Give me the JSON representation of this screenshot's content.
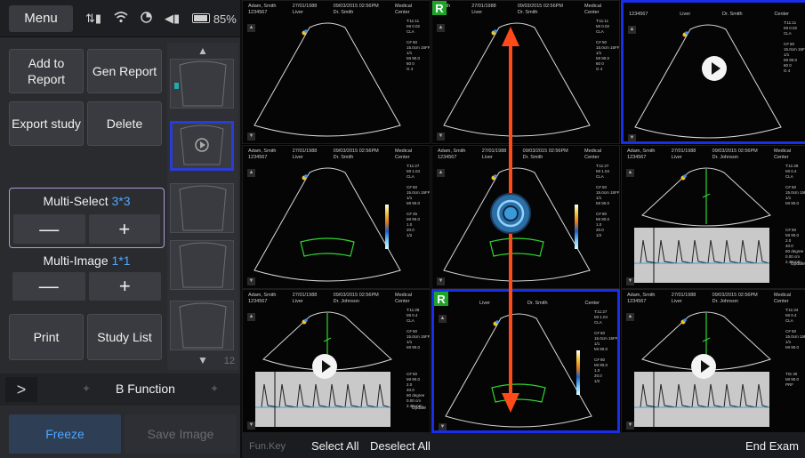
{
  "menu": {
    "label": "Menu"
  },
  "status": {
    "battery": "85%"
  },
  "buttons": {
    "add_to_report": "Add to\nReport",
    "gen_report": "Gen Report",
    "export_study": "Export study",
    "delete": "Delete",
    "print": "Print",
    "study_list": "Study List",
    "freeze": "Freeze",
    "save_image": "Save Image"
  },
  "multi_select": {
    "label": "Multi-Select",
    "value": "3*3",
    "minus": "—",
    "plus": "+"
  },
  "multi_image": {
    "label": "Multi-Image",
    "value": "1*1",
    "minus": "—",
    "plus": "+"
  },
  "thumbs": {
    "count": "12"
  },
  "bfunction": {
    "arrow": ">",
    "label": "B Function"
  },
  "bottom": {
    "fun_key": "Fun.Key",
    "select_all": "Select All",
    "deselect_all": "Deselect All",
    "end_exam": "End Exam"
  },
  "cells": [
    {
      "patient": "Adam, Smith\n1234567",
      "date": "27/01/1988\nLiver",
      "time": "09/03/2015 02:56PM\nDr. Smith",
      "center": "Medical\nCenter",
      "params": "T:11:11\nMI 0.02\nCLA\n\nC# 50\n15.0cm 15FPS\n1/1\nMI 90.0\n60 0\nG 4"
    },
    {
      "patient": "Smith\n",
      "date": "27/01/1988\nLiver",
      "time": "09/03/2015 02:56PM\nDr. Smith",
      "center": "Medical\nCenter",
      "params": "T:11:11\nMI 0.02\nCLA\n\nC# 50\n15.0cm 15FPS\n1/1\nMI 90.0\n60 0\nG 4",
      "tag": "R"
    },
    {
      "patient": "\n1234567",
      "date": "\nLiver",
      "time": "\nDr. Smith",
      "center": "\nCenter",
      "params": "T:11:11\nMI 0.02\nCLA\n\nC# 50\n15.0cm 15FPS\n1/1\nMI 90.0\n60 0\nG 4"
    },
    {
      "patient": "Adam, Smith\n1234567",
      "date": "27/01/1988\nLiver",
      "time": "09/03/2015 02:56PM\nDr. Smith",
      "center": "Medical\nCenter",
      "params": "T:11:27\nMI 1.04\nCLA\n\nC# 50\n15.0cm 15FPS\n1/1\nMI 90.0\n\nC# 45\nMI 90.0\n1.0\n20.0\n1/2"
    },
    {
      "patient": "Adam, Smith\n1234567",
      "date": "27/01/1988\nLiver",
      "time": "09/03/2015 02:56PM\nDr. Smith",
      "center": "Medical\nCenter",
      "params": "T:11:27\nMI 1.04\nCLA\n\nC# 50\n15.0cm 15FPS\n1/1\nMI 90.0\n\nC# 80\nMI 90.0\n1.0\n20.0\n1/2"
    },
    {
      "patient": "Adam, Smith\n1234567",
      "date": "27/01/1988\nLiver",
      "time": "09/03/2015 02:56PM\nDr. Johnson",
      "center": "Medical\nCenter",
      "params": "T:11:28\nMI 0.4\nCLA\n\nC# 50\n15.0cm 15FPS\n1/1\nMI 90.0\n\n\n\n\nC# 50\nMI 90.0\n2.0\n40.0\n60 degree\n0.00 cm\n2.48 mm",
      "update": "Update"
    },
    {
      "patient": "Adam, Smith\n1234567",
      "date": "27/01/1988\nLiver",
      "time": "09/03/2015 02:56PM\nDr. Johnson",
      "center": "Medical\nCenter",
      "params": "T:11:28\nMI 0.4\nCLA\n\nC# 50\n15.0cm 15FPS\n1/1\nMI 90.0\n\n\n\n\nC# 50\nMI 90.0\n2.0\n40.0\n60 degree\n0.00 cm\n2.48 mm",
      "update": "Update"
    },
    {
      "patient": "7\n",
      "date": "\nLiver",
      "time": "\nDr. Smith",
      "center": "\nCenter",
      "params": "T:11:27\nMI 1.04\nCLA\n\nC# 50\n15.0cm 15FPS\n1/1\nMI 90.0\n\nC# 80\nMI 90.0\n1.0\n20.0\n1/2",
      "tag": "R"
    },
    {
      "patient": "Adam, Smith\n1234567",
      "date": "27/01/1988\nLiver",
      "time": "09/03/2015 02:56PM\nDr. Johnson",
      "center": "Medical\nCenter",
      "params": "T:11:34\nMI 0.4\nCLA\n\nC# 50\n15.0cm 15FPS\n1/1\nMI 90.0\n\n\n\n\nTIS 30\nMI 90.0\nPRF"
    }
  ]
}
